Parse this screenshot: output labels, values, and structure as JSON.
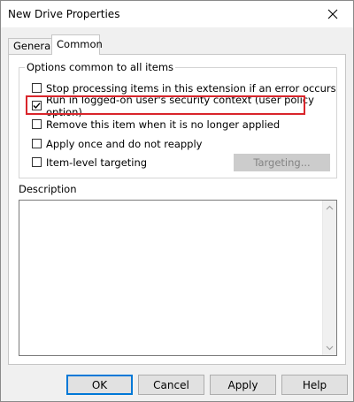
{
  "window": {
    "title": "New Drive Properties",
    "close_glyph": "✕"
  },
  "tabs": [
    {
      "label": "General",
      "active": false
    },
    {
      "label": "Common",
      "active": true
    }
  ],
  "options_group": {
    "title": "Options common to all items",
    "items": [
      {
        "label": "Stop processing items in this extension if an error occurs",
        "checked": false
      },
      {
        "label": "Run in logged-on user's security context (user policy option)",
        "checked": true,
        "highlighted": true
      },
      {
        "label": "Remove this item when it is no longer applied",
        "checked": false
      },
      {
        "label": "Apply once and do not reapply",
        "checked": false
      },
      {
        "label": "Item-level targeting",
        "checked": false
      }
    ],
    "targeting_button": "Targeting..."
  },
  "description": {
    "label": "Description",
    "value": ""
  },
  "buttons": {
    "ok": "OK",
    "cancel": "Cancel",
    "apply": "Apply",
    "help": "Help"
  },
  "colors": {
    "highlight": "#d9252b",
    "default_button_border": "#0078d7"
  }
}
